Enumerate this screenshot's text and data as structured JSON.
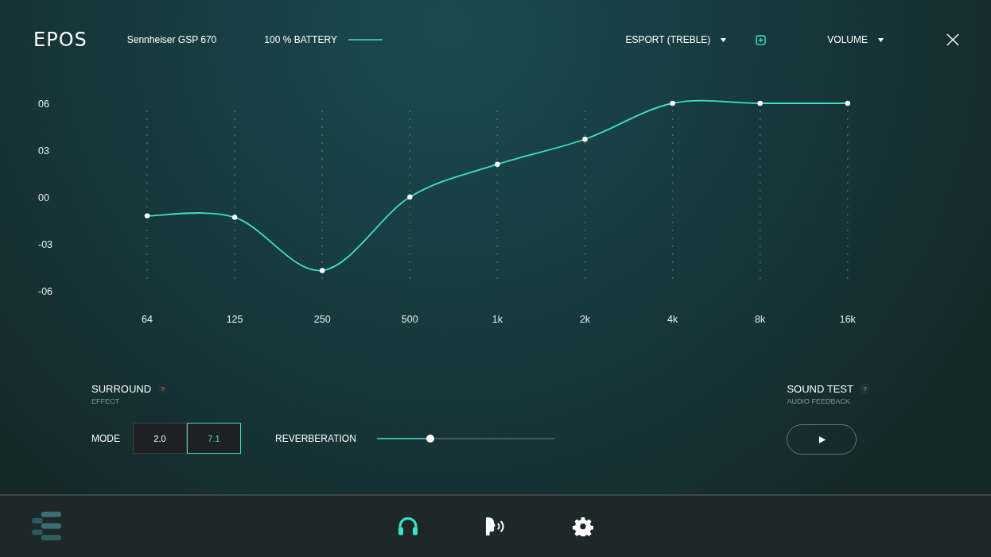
{
  "header": {
    "logo": "EPOS",
    "device": "Sennheiser GSP 670",
    "battery": {
      "label": "100 % BATTERY",
      "level": 1
    },
    "preset": "ESPORT (TREBLE)",
    "volume": "VOLUME"
  },
  "equalizer": {
    "chart_data": {
      "type": "line",
      "categories": [
        "64",
        "125",
        "250",
        "500",
        "1k",
        "2k",
        "4k",
        "8k",
        "16k"
      ],
      "series": [
        {
          "color": "#3fe0c5",
          "marker": "circle",
          "values": [
            -1.2,
            -1.3,
            -4.7,
            0,
            2.1,
            3.7,
            6,
            6,
            6
          ]
        }
      ],
      "ylim": [
        -6,
        6
      ],
      "yticks": [
        {
          "value": 6,
          "label": "06"
        },
        {
          "value": 3,
          "label": "03"
        },
        {
          "value": 0,
          "label": "00"
        },
        {
          "value": -3,
          "label": "-03"
        },
        {
          "value": -6,
          "label": "-06"
        }
      ]
    }
  },
  "surround": {
    "title": "SURROUND",
    "help": "?",
    "subtitle": "EFFECT",
    "mode_label": "MODE",
    "modes": [
      {
        "label": "2.0",
        "selected": false
      },
      {
        "label": "7.1",
        "selected": true
      }
    ],
    "reverb_label": "REVERBERATION",
    "reverb": {
      "level": 0.3
    }
  },
  "sound_test": {
    "title": "SOUND TEST",
    "help": "?",
    "subtitle": "AUDIO FEEDBACK"
  },
  "nav": [
    {
      "kind": "headphones",
      "selected": true
    },
    {
      "kind": "voice",
      "selected": false
    },
    {
      "kind": "settings",
      "selected": false
    }
  ]
}
